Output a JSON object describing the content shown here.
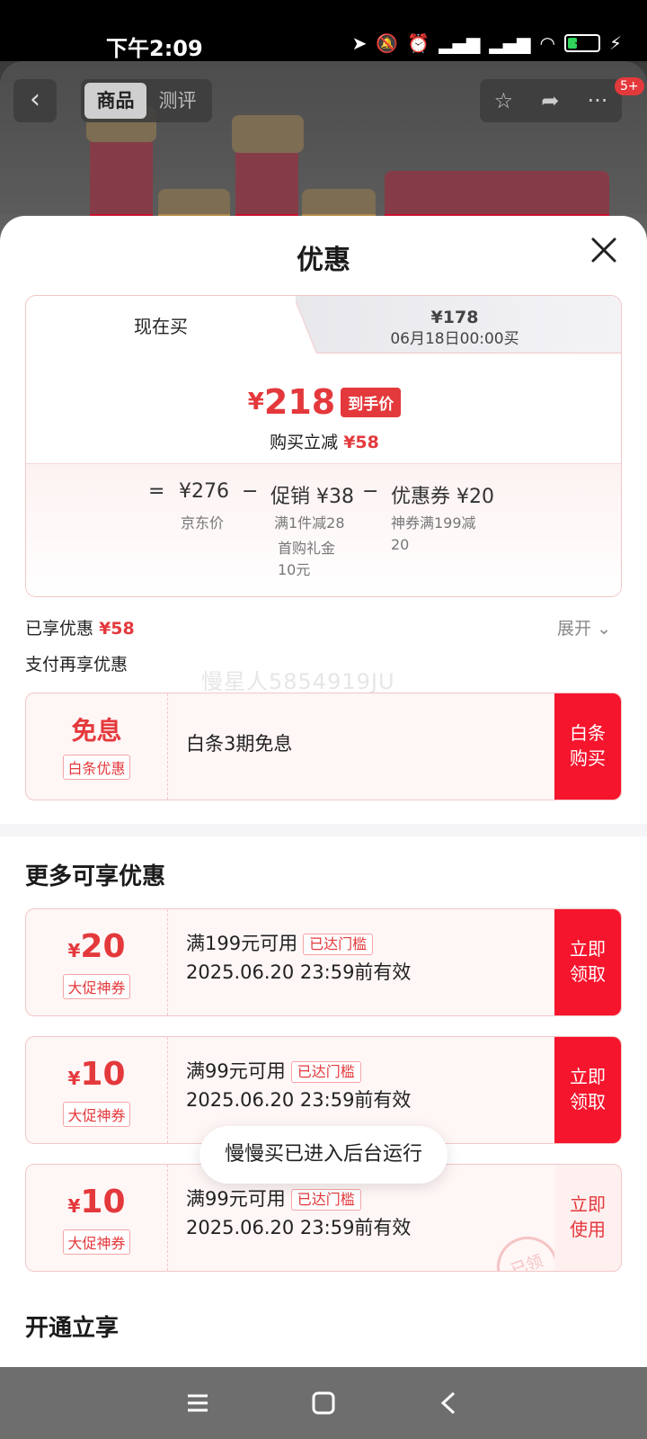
{
  "status": {
    "time": "下午2:09",
    "battery": "31",
    "battery_level": 0.31
  },
  "product_nav": {
    "tabs": [
      {
        "label": "商品"
      },
      {
        "label": "测评"
      }
    ],
    "badge": "5+"
  },
  "sheet": {
    "title": "优惠"
  },
  "price_tabs": {
    "now": "现在买",
    "later_price": "¥178",
    "later_time": "06月18日00:00买"
  },
  "final_price": {
    "yen": "¥",
    "value": "218",
    "tag": "到手价",
    "save_label": "购买立减",
    "save_value": "¥58"
  },
  "formula": {
    "eq": "=",
    "minus": "−",
    "jd_price": "¥276",
    "jd_label": "京东价",
    "promo": "促销 ¥38",
    "promo_detail1": "满1件减28",
    "promo_detail2": "首购礼金",
    "promo_detail3": "10元",
    "coupon": "优惠券 ¥20",
    "coupon_detail1": "神券满199减",
    "coupon_detail2": "20"
  },
  "enjoyed": {
    "label": "已享优惠",
    "value": "¥58",
    "expand": "展开"
  },
  "pay_more": {
    "label": "支付再享优惠"
  },
  "watermark": "慢星人5854919JU",
  "baitiao": {
    "title": "免息",
    "tag": "白条优惠",
    "desc": "白条3期免息",
    "btn_line1": "白条",
    "btn_line2": "购买"
  },
  "more": {
    "title": "更多可享优惠"
  },
  "coupons": [
    {
      "yen": "¥",
      "amount": "20",
      "tag": "大促神券",
      "cond": "满199元可用",
      "threshold": "已达门槛",
      "expiry": "2025.06.20 23:59前有效",
      "btn1": "立即",
      "btn2": "领取"
    },
    {
      "yen": "¥",
      "amount": "10",
      "tag": "大促神券",
      "cond": "满99元可用",
      "threshold": "已达门槛",
      "expiry": "2025.06.20 23:59前有效",
      "btn1": "立即",
      "btn2": "领取"
    },
    {
      "yen": "¥",
      "amount": "10",
      "tag": "大促神券",
      "cond": "满99元可用",
      "threshold": "已达门槛",
      "expiry": "2025.06.20 23:59前有效",
      "btn1": "立即",
      "btn2": "使用",
      "stamp": "已领"
    }
  ],
  "open": {
    "title": "开通立享"
  },
  "toast": "慢慢买已进入后台运行",
  "colors": {
    "accent": "#e4393c",
    "button_red": "#f5152d"
  }
}
